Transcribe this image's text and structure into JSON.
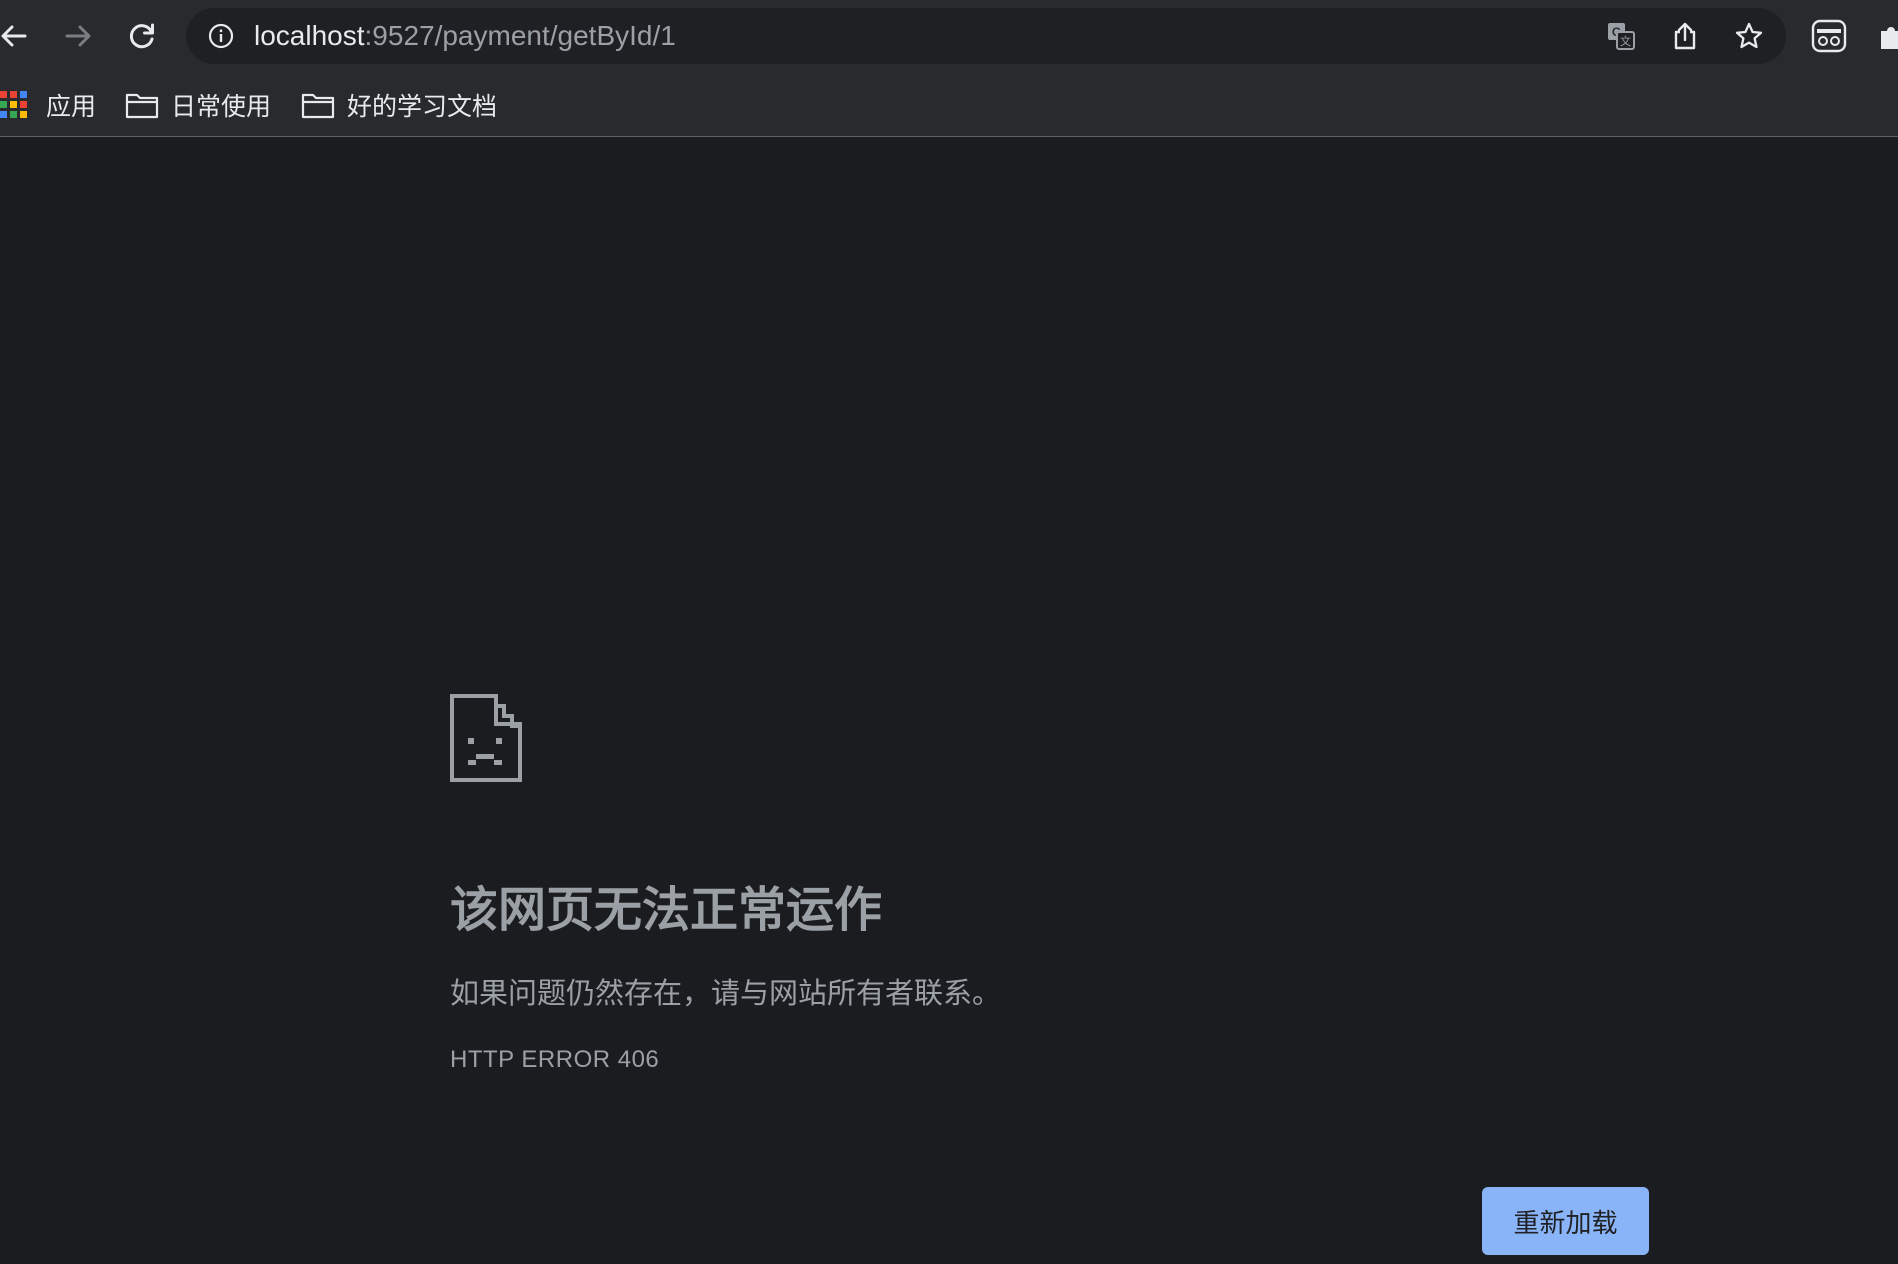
{
  "toolbar": {
    "back_icon": "back-arrow-icon",
    "forward_icon": "forward-arrow-icon",
    "reload_icon": "reload-icon",
    "omnibox": {
      "security_icon": "info-icon",
      "url_host": "localhost",
      "url_path": ":9527/payment/getById/1",
      "translate_icon": "translate-icon",
      "share_icon": "share-icon",
      "bookmark_icon": "star-icon"
    },
    "extensions": [
      "incognito-profile-icon",
      "puzzle-extensions-icon"
    ]
  },
  "bookmarks": {
    "items": [
      {
        "label": "应用",
        "icon": "apps-grid-icon"
      },
      {
        "label": "日常使用",
        "icon": "folder-icon"
      },
      {
        "label": "好的学习文档",
        "icon": "folder-icon"
      }
    ]
  },
  "error": {
    "icon": "sad-page-icon",
    "title": "该网页无法正常运作",
    "description": "如果问题仍然存在，请与网站所有者联系。",
    "code": "HTTP ERROR 406",
    "reload_label": "重新加载"
  },
  "colors": {
    "page_background": "#1b1c1f",
    "toolbar_background": "#292a2d",
    "omnibox_background": "#1f2023",
    "primary_text": "#e8eaed",
    "secondary_text": "#9aa0a6",
    "button_accent": "#8ab4f8"
  }
}
